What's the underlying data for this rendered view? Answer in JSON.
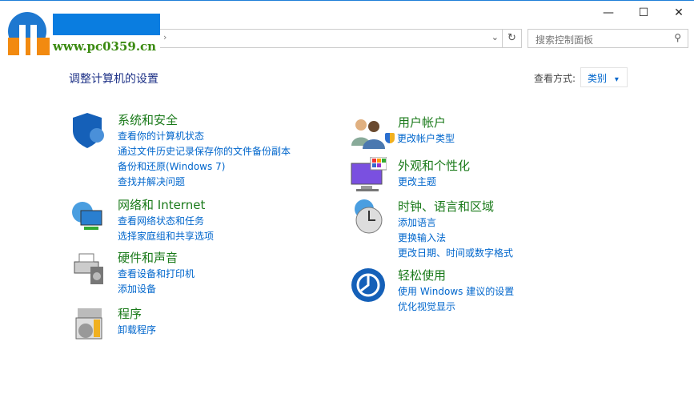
{
  "watermark": {
    "url": "www.pc0359.cn"
  },
  "window": {
    "minimize": "—",
    "maximize": "☐",
    "close": "✕"
  },
  "address": {
    "chevron": "›",
    "dropdown": "⌄",
    "refresh": "↻"
  },
  "search": {
    "placeholder": "搜索控制面板",
    "icon": "⚲"
  },
  "page": {
    "title": "调整计算机的设置",
    "view_by_label": "查看方式:",
    "view_by_value": "类别",
    "view_by_arrow": "▾"
  },
  "categories": [
    {
      "title": "系统和安全",
      "links": [
        "查看你的计算机状态",
        "通过文件历史记录保存你的文件备份副本",
        "备份和还原(Windows 7)",
        "查找并解决问题"
      ]
    },
    {
      "title": "网络和 Internet",
      "links": [
        "查看网络状态和任务",
        "选择家庭组和共享选项"
      ]
    },
    {
      "title": "硬件和声音",
      "links": [
        "查看设备和打印机",
        "添加设备"
      ]
    },
    {
      "title": "程序",
      "links": [
        "卸载程序"
      ]
    },
    {
      "title": "用户帐户",
      "links": [
        "更改帐户类型"
      ]
    },
    {
      "title": "外观和个性化",
      "links": [
        "更改主题"
      ]
    },
    {
      "title": "时钟、语言和区域",
      "links": [
        "添加语言",
        "更换输入法",
        "更改日期、时间或数字格式"
      ]
    },
    {
      "title": "轻松使用",
      "links": [
        "使用 Windows 建议的设置",
        "优化视觉显示"
      ]
    }
  ]
}
